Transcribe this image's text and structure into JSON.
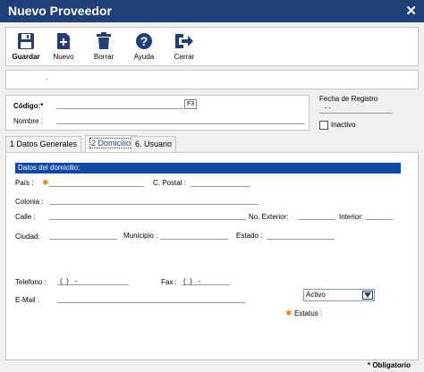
{
  "window": {
    "title": "Nuevo Proveedor"
  },
  "toolbar": {
    "buttons": [
      {
        "label": "Guardar",
        "icon": "save-icon"
      },
      {
        "label": "Nuevo",
        "icon": "new-document-icon"
      },
      {
        "label": "Borrar",
        "icon": "trash-icon"
      },
      {
        "label": "Ayuda",
        "icon": "help-icon"
      },
      {
        "label": "Cerrar",
        "icon": "exit-icon"
      }
    ]
  },
  "infostrip": {
    "text": "."
  },
  "header": {
    "codigo_label": "Código:*",
    "f3_label": "F3",
    "nombre_label": "Nombre :",
    "fecha_label": "Fecha de Registro",
    "fecha_value": "- -",
    "inactivo_label": "Inactivo"
  },
  "tabs": [
    {
      "label": "1 Datos Generales"
    },
    {
      "label": "2 Domicilio"
    },
    {
      "label": "6. Usuario"
    }
  ],
  "domicilio": {
    "section_title": "Datos del domicilio:",
    "pais_label": "País :",
    "cpostal_label": "C. Postal :",
    "colonia_label": "Colonia :",
    "calle_label": "Calle :",
    "noext_label": "No. Exterior:",
    "interior_label": "Interior:",
    "ciudad_label": "Ciudad:",
    "municipio_label": "Municipio :",
    "estado_label": "Estado :",
    "telefono_label": "Telefono :",
    "telefono_value": "(  )   -",
    "fax_label": "Fax :",
    "fax_value": "(  )   -",
    "email_label": "E-Mail :",
    "estatus_value": "Activo",
    "estatus_label": "Estatus :"
  },
  "footer": {
    "obligatorio": "* Obligatorio"
  },
  "colors": {
    "titlebar": "#1e3f78",
    "section_bar": "#0f4aa8",
    "required_star": "#e08a00"
  }
}
